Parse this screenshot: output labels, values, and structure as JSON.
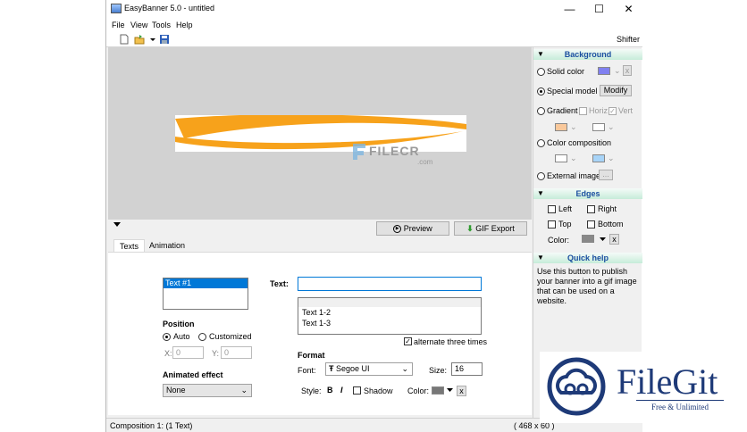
{
  "window": {
    "title": "EasyBanner 5.0 - untitled",
    "minimize": "—",
    "maximize": "☐",
    "close": "✕"
  },
  "menu": [
    "File",
    "View",
    "Tools",
    "Help"
  ],
  "toolbar": {
    "shifter": "Shifter"
  },
  "watermark": {
    "text": "FILECR",
    "sub": ".com"
  },
  "actions": {
    "preview": "Preview",
    "gif_export": "GIF Export"
  },
  "tabs": [
    "Texts",
    "Animation"
  ],
  "texts": {
    "list": [
      "Text #1"
    ],
    "text_label": "Text:",
    "text_value": "",
    "position_label": "Position",
    "auto": "Auto",
    "customized": "Customized",
    "x_label": "X:",
    "x_value": "0",
    "y_label": "Y:",
    "y_value": "0",
    "effect_label": "Animated effect",
    "effect_value": "None",
    "alt_items": [
      "Text 1-2",
      "Text 1-3"
    ],
    "alternate": "alternate three times",
    "format_label": "Format",
    "font_label": "Font:",
    "font_value": "Segoe UI",
    "size_label": "Size:",
    "size_value": "16",
    "style_label": "Style:",
    "bold": "B",
    "italic": "I",
    "shadow": "Shadow",
    "color_label": "Color:",
    "x_btn": "x"
  },
  "status": {
    "left": "Composition 1:  (1 Text)",
    "right": "( 468 x 60 )"
  },
  "background": {
    "title": "Background",
    "solid": "Solid color",
    "special": "Special model",
    "modify": "Modify",
    "gradient": "Gradient",
    "horiz": "Horiz",
    "vert": "Vert",
    "composition": "Color composition",
    "external": "External image",
    "browse": "..."
  },
  "edges": {
    "title": "Edges",
    "left": "Left",
    "right": "Right",
    "top": "Top",
    "bottom": "Bottom",
    "color": "Color:"
  },
  "quickhelp": {
    "title": "Quick help",
    "text": "Use this button to publish your banner into a gif image that can be used on a website."
  },
  "logo": {
    "name": "FileGit",
    "tagline": "Free & Unlimited"
  },
  "colors": {
    "solid": "#8080f0",
    "gradient1": "#f9c89b",
    "composition2": "#a8d4f8",
    "edge": "#888888",
    "textcolor": "#777777",
    "orange": "#f7a21b"
  }
}
